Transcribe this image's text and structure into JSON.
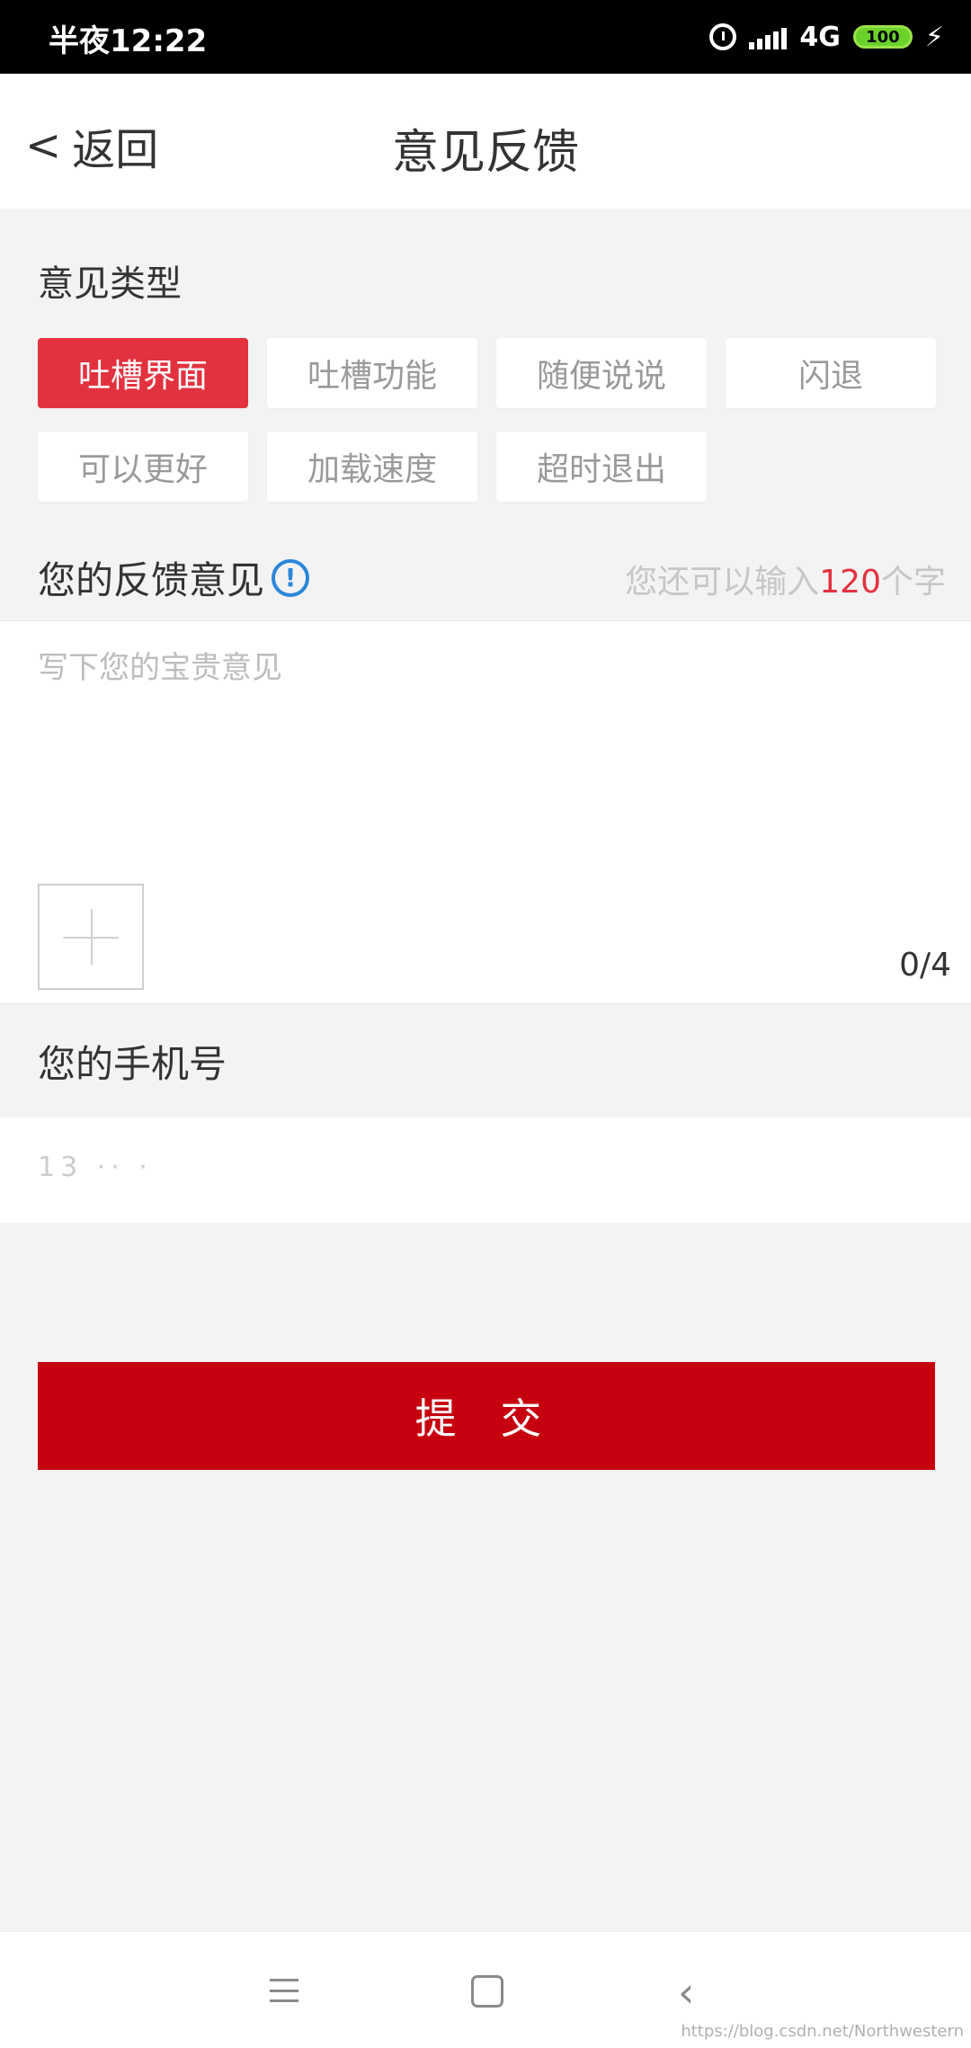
{
  "status_bar": {
    "time": "半夜12:22",
    "network": "4G",
    "battery": "100"
  },
  "header": {
    "back_label": "返回",
    "title": "意见反馈"
  },
  "feedback_type": {
    "label": "意见类型",
    "options": [
      "吐槽界面",
      "吐槽功能",
      "随便说说",
      "闪退",
      "可以更好",
      "加载速度",
      "超时退出"
    ],
    "selected": "吐槽界面"
  },
  "feedback": {
    "label": "您的反馈意见",
    "remaining_prefix": "您还可以输入",
    "remaining_count": "120",
    "remaining_suffix": "个字",
    "placeholder": "写下您的宝贵意见",
    "image_count": "0/4"
  },
  "phone": {
    "label": "您的手机号",
    "value": "13 ·· ·"
  },
  "submit_label": "提 交",
  "watermark": "https://blog.csdn.net/Northwestern",
  "colors": {
    "accent": "#e3323f",
    "submit": "#c6000f",
    "info_icon": "#2b86d9",
    "background": "#f3f3f4"
  }
}
